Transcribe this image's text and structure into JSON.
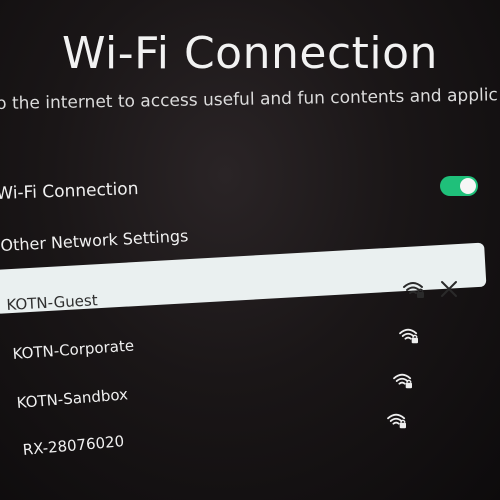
{
  "page": {
    "title": "Wi-Fi Connection",
    "subtitle": "o the internet to access useful and fun contents and applic"
  },
  "settings": {
    "wifi_connection_label": "Wi-Fi Connection",
    "wifi_connection_enabled": true,
    "other_network_settings_label": "Other Network Settings"
  },
  "networks": [
    {
      "name": "KOTN-Guest",
      "secured": true,
      "focused": true,
      "icon": "wifi-lock-icon",
      "action_icon": "close-icon"
    },
    {
      "name": "KOTN-Corporate",
      "secured": true,
      "focused": false,
      "icon": "wifi-lock-icon"
    },
    {
      "name": "KOTN-Sandbox",
      "secured": true,
      "focused": false,
      "icon": "wifi-lock-icon"
    },
    {
      "name": "RX-28076020",
      "secured": true,
      "focused": false,
      "icon": "wifi-lock-icon"
    }
  ],
  "colors": {
    "background": "#1a1617",
    "toggle_on": "#1fc07a",
    "focus_bar": "#eaf0f0",
    "text": "#f0f0f0"
  }
}
